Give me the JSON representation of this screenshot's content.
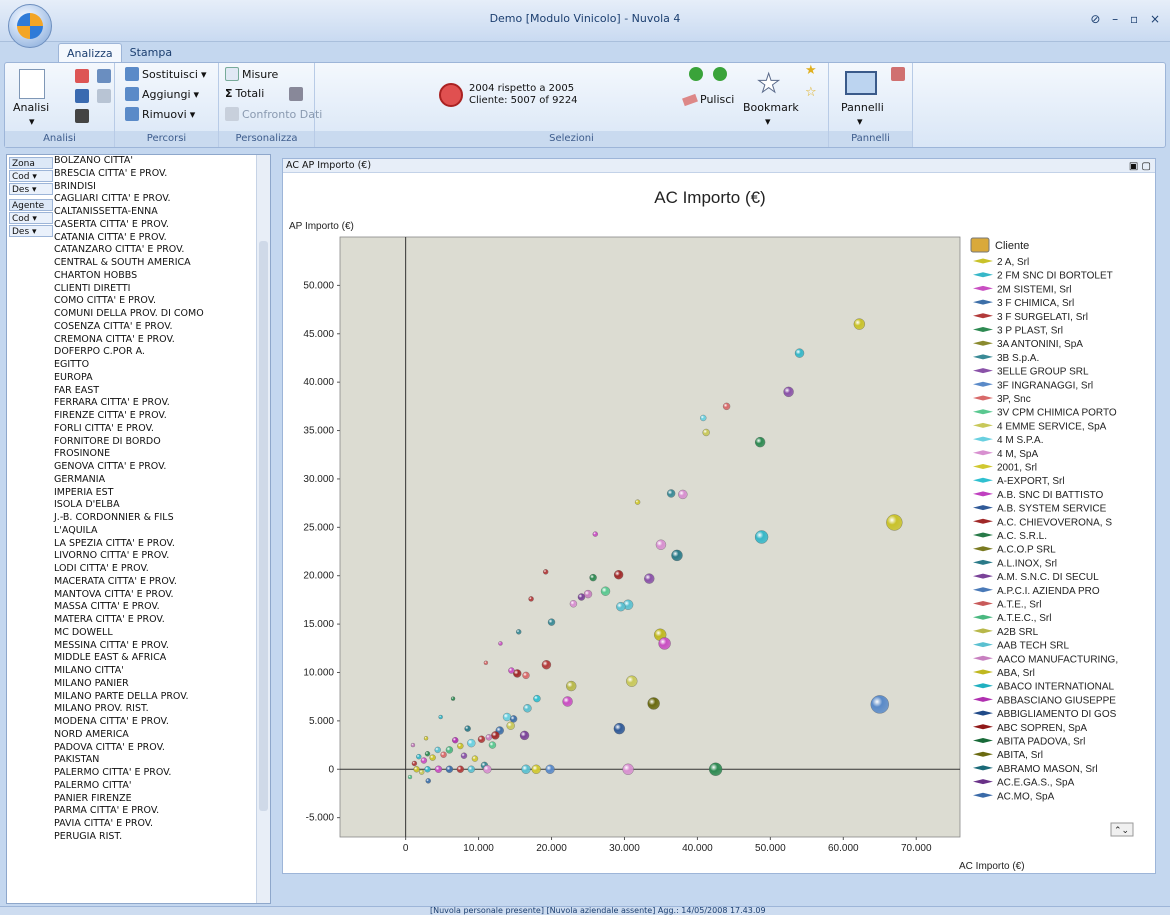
{
  "window": {
    "title": "Demo [Modulo Vinicolo] - Nuvola 4",
    "controls": "⊘ – ▫ ×"
  },
  "ribbon_tabs": [
    {
      "label": "Analizza",
      "active": true
    },
    {
      "label": "Stampa",
      "active": false
    }
  ],
  "ribbon": {
    "analisi": {
      "big_label": "Analisi",
      "group_label": "Analisi"
    },
    "percorsi": {
      "sostituisci": "Sostituisci",
      "aggiungi": "Aggiungi",
      "rimuovi": "Rimuovi",
      "group_label": "Percorsi"
    },
    "personalizza": {
      "misure": "Misure",
      "totali": "Totali",
      "confronto": "Confronto Dati",
      "group_label": "Personalizza"
    },
    "selezioni": {
      "line1": "2004 rispetto a  2005",
      "line2": "Cliente: 5007 of 9224",
      "pulisci": "Pulisci",
      "bookmark": "Bookmark",
      "group_label": "Selezioni"
    },
    "pannelli": {
      "label": "Pannelli",
      "group_label": "Pannelli"
    }
  },
  "left_panel": {
    "dimensions": [
      {
        "label": "Zona",
        "head": true
      },
      {
        "label": "Cod",
        "head": false
      },
      {
        "label": "Des",
        "head": false
      },
      {
        "label": "Agente",
        "head": true
      },
      {
        "label": "Cod",
        "head": false
      },
      {
        "label": "Des",
        "head": false
      }
    ],
    "zones": [
      "BOLZANO CITTA'",
      "BRESCIA CITTA' E PROV.",
      "BRINDISI",
      "CAGLIARI CITTA' E PROV.",
      "CALTANISSETTA-ENNA",
      "CASERTA CITTA' E PROV.",
      "CATANIA CITTA' E PROV.",
      "CATANZARO CITTA' E PROV.",
      "CENTRAL & SOUTH AMERICA",
      "CHARTON HOBBS",
      "CLIENTI DIRETTI",
      "COMO CITTA' E PROV.",
      "COMUNI DELLA PROV. DI COMO",
      "COSENZA CITTA' E PROV.",
      "CREMONA CITTA' E PROV.",
      "DOFERPO C.POR A.",
      "EGITTO",
      "EUROPA",
      "FAR EAST",
      "FERRARA CITTA' E PROV.",
      "FIRENZE CITTA' E PROV.",
      "FORLI CITTA' E PROV.",
      "FORNITORE DI BORDO",
      "FROSINONE",
      "GENOVA CITTA' E PROV.",
      "GERMANIA",
      "IMPERIA EST",
      "ISOLA D'ELBA",
      "J.-B. CORDONNIER & FILS",
      "L'AQUILA",
      "LA SPEZIA CITTA' E PROV.",
      "LIVORNO CITTA' E PROV.",
      "LODI CITTA' E PROV.",
      "MACERATA CITTA' E PROV.",
      "MANTOVA CITTA' E PROV.",
      "MASSA CITTA' E PROV.",
      "MATERA CITTA' E PROV.",
      "MC DOWELL",
      "MESSINA CITTA' E PROV.",
      "MIDDLE EAST & AFRICA",
      "MILANO CITTA'",
      "MILANO PANIER",
      "MILANO PARTE DELLA PROV.",
      "MILANO PROV. RIST.",
      "MODENA CITTA' E PROV.",
      "NORD AMERICA",
      "PADOVA CITTA' E PROV.",
      "PAKISTAN",
      "PALERMO  CITTA' E PROV.",
      "PALERMO CITTA'",
      "PANIER FIRENZE",
      "PARMA CITTA' E PROV.",
      "PAVIA CITTA' E PROV.",
      "PERUGIA RIST."
    ]
  },
  "chart_panel": {
    "header": "AC AP Importo (€)"
  },
  "chart_data": {
    "type": "scatter",
    "title": "AC Importo (€)",
    "xlabel": "AC Importo (€)",
    "ylabel": "AP Importo (€)",
    "xlim": [
      -9000,
      76000
    ],
    "ylim": [
      -7000,
      55000
    ],
    "xticks": [
      0,
      10000,
      20000,
      30000,
      40000,
      50000,
      60000,
      70000
    ],
    "xtick_labels": [
      "0",
      "10.000",
      "20.000",
      "30.000",
      "40.000",
      "50.000",
      "60.000",
      "70.000"
    ],
    "yticks": [
      -5000,
      0,
      5000,
      10000,
      15000,
      20000,
      25000,
      30000,
      35000,
      40000,
      45000,
      50000
    ],
    "ytick_labels": [
      "-5.000",
      "0",
      "5.000",
      "10.000",
      "15.000",
      "20.000",
      "25.000",
      "30.000",
      "35.000",
      "40.000",
      "45.000",
      "50.000"
    ],
    "plot_bg": "#dcdcd2",
    "legend_title": "Cliente",
    "legend": [
      {
        "name": "2 A, Srl",
        "color": "#c9c22a"
      },
      {
        "name": "2 FM SNC DI BORTOLET",
        "color": "#36b7c8"
      },
      {
        "name": "2M SISTEMI, Srl",
        "color": "#c94fc2"
      },
      {
        "name": "3 F CHIMICA, Srl",
        "color": "#3d6fa8"
      },
      {
        "name": "3 F SURGELATI, Srl",
        "color": "#b23a3a"
      },
      {
        "name": "3 P PLAST, Srl",
        "color": "#2e8a52"
      },
      {
        "name": "3A ANTONINI, SpA",
        "color": "#8a8a2e"
      },
      {
        "name": "3B S.p.A.",
        "color": "#3a8a96"
      },
      {
        "name": "3ELLE GROUP SRL",
        "color": "#8a52a8"
      },
      {
        "name": "3F INGRANAGGI, Srl",
        "color": "#5a8ac8"
      },
      {
        "name": "3P, Snc",
        "color": "#d86a6a"
      },
      {
        "name": "3V CPM CHIMICA PORTO",
        "color": "#5ac890"
      },
      {
        "name": "4 EMME SERVICE, SpA",
        "color": "#c8c85a"
      },
      {
        "name": "4 M S.P.A.",
        "color": "#6ad0e0"
      },
      {
        "name": "4 M, SpA",
        "color": "#d890d0"
      },
      {
        "name": "2001, Srl",
        "color": "#d0c830"
      },
      {
        "name": "A-EXPORT, Srl",
        "color": "#30c0d0"
      },
      {
        "name": "A.B. SNC DI BATTISTO",
        "color": "#c040c0"
      },
      {
        "name": "A.B. SYSTEM SERVICE",
        "color": "#305a98"
      },
      {
        "name": "A.C. CHIEVOVERONA, S",
        "color": "#a02828"
      },
      {
        "name": "A.C. S.R.L.",
        "color": "#287a48"
      },
      {
        "name": "A.C.O.P SRL",
        "color": "#7a7a20"
      },
      {
        "name": "A.L.INOX, Srl",
        "color": "#2a7a88"
      },
      {
        "name": "A.M. S.N.C. DI SECUL",
        "color": "#7a4298"
      },
      {
        "name": "A.P.C.I. AZIENDA PRO",
        "color": "#4a7ab8"
      },
      {
        "name": "A.T.E., Srl",
        "color": "#c85a5a"
      },
      {
        "name": "A.T.E.C., Srl",
        "color": "#4ab880"
      },
      {
        "name": "A2B SRL",
        "color": "#b8b84a"
      },
      {
        "name": "AAB TECH SRL",
        "color": "#5ac0d0"
      },
      {
        "name": "AACO MANUFACTURING,",
        "color": "#c880c0"
      },
      {
        "name": "ABA, Srl",
        "color": "#c0b820"
      },
      {
        "name": "ABACO INTERNATIONAL",
        "color": "#20b0c0"
      },
      {
        "name": "ABBASCIANO GIUSEPPE",
        "color": "#b030b0"
      },
      {
        "name": "ABBIGLIAMENTO DI GOS",
        "color": "#204a88"
      },
      {
        "name": "ABC SOPREN, SpA",
        "color": "#901818"
      },
      {
        "name": "ABITA PADOVA, Srl",
        "color": "#186a38"
      },
      {
        "name": "ABITA, Srl",
        "color": "#6a6a10"
      },
      {
        "name": "ABRAMO MASON, Srl",
        "color": "#1a6a78"
      },
      {
        "name": "AC.E.GA.S., SpA",
        "color": "#6a3288"
      },
      {
        "name": "AC.MO, SpA",
        "color": "#3a6aa8"
      }
    ],
    "points": [
      {
        "x": 62200,
        "y": 46000,
        "size": 9,
        "color": "#c9c22a"
      },
      {
        "x": 54000,
        "y": 43000,
        "size": 7,
        "color": "#36b7c8"
      },
      {
        "x": 52500,
        "y": 39000,
        "size": 8,
        "color": "#8a52a8"
      },
      {
        "x": 44000,
        "y": 37500,
        "size": 5,
        "color": "#d86a6a"
      },
      {
        "x": 40800,
        "y": 36300,
        "size": 4,
        "color": "#6ad0e0"
      },
      {
        "x": 41200,
        "y": 34800,
        "size": 5,
        "color": "#c8c85a"
      },
      {
        "x": 48600,
        "y": 33800,
        "size": 8,
        "color": "#2e8a52"
      },
      {
        "x": 36400,
        "y": 28500,
        "size": 6,
        "color": "#3a8a96"
      },
      {
        "x": 38000,
        "y": 28400,
        "size": 7,
        "color": "#d890d0"
      },
      {
        "x": 31800,
        "y": 27600,
        "size": 3,
        "color": "#d0c830"
      },
      {
        "x": 67000,
        "y": 25500,
        "size": 14,
        "color": "#c9c22a"
      },
      {
        "x": 48800,
        "y": 24000,
        "size": 11,
        "color": "#36b7c8"
      },
      {
        "x": 26000,
        "y": 24300,
        "size": 3,
        "color": "#c94fc2"
      },
      {
        "x": 35000,
        "y": 23200,
        "size": 8,
        "color": "#d890d0"
      },
      {
        "x": 37200,
        "y": 22100,
        "size": 9,
        "color": "#2a7a88"
      },
      {
        "x": 19200,
        "y": 20400,
        "size": 3,
        "color": "#b23a3a"
      },
      {
        "x": 29200,
        "y": 20100,
        "size": 7,
        "color": "#a02828"
      },
      {
        "x": 33400,
        "y": 19700,
        "size": 8,
        "color": "#8a52a8"
      },
      {
        "x": 25700,
        "y": 19800,
        "size": 5,
        "color": "#2e8a52"
      },
      {
        "x": 27400,
        "y": 18400,
        "size": 7,
        "color": "#5ac890"
      },
      {
        "x": 25000,
        "y": 18100,
        "size": 6,
        "color": "#c880c0"
      },
      {
        "x": 24100,
        "y": 17800,
        "size": 5,
        "color": "#7a4298"
      },
      {
        "x": 30500,
        "y": 17000,
        "size": 8,
        "color": "#5ac0d0"
      },
      {
        "x": 29500,
        "y": 16800,
        "size": 7,
        "color": "#5ac0d0"
      },
      {
        "x": 23000,
        "y": 17100,
        "size": 5,
        "color": "#d890d0"
      },
      {
        "x": 17200,
        "y": 17600,
        "size": 3,
        "color": "#b23a3a"
      },
      {
        "x": 20000,
        "y": 15200,
        "size": 5,
        "color": "#3a8a96"
      },
      {
        "x": 34900,
        "y": 13900,
        "size": 10,
        "color": "#c0b820"
      },
      {
        "x": 35500,
        "y": 13000,
        "size": 10,
        "color": "#c94fc2"
      },
      {
        "x": 15500,
        "y": 14200,
        "size": 3,
        "color": "#3a8a96"
      },
      {
        "x": 19300,
        "y": 10800,
        "size": 7,
        "color": "#b23a3a"
      },
      {
        "x": 15300,
        "y": 9900,
        "size": 6,
        "color": "#a02828"
      },
      {
        "x": 16500,
        "y": 9700,
        "size": 5,
        "color": "#d86a6a"
      },
      {
        "x": 14500,
        "y": 10200,
        "size": 4,
        "color": "#c94fc2"
      },
      {
        "x": 31000,
        "y": 9100,
        "size": 9,
        "color": "#c8c85a"
      },
      {
        "x": 22700,
        "y": 8600,
        "size": 8,
        "color": "#b8b84a"
      },
      {
        "x": 65000,
        "y": 6700,
        "size": 16,
        "color": "#5a8ac8"
      },
      {
        "x": 34000,
        "y": 6800,
        "size": 10,
        "color": "#6a6a10"
      },
      {
        "x": 22200,
        "y": 7000,
        "size": 8,
        "color": "#c94fc2"
      },
      {
        "x": 18000,
        "y": 7300,
        "size": 5,
        "color": "#30c0d0"
      },
      {
        "x": 16700,
        "y": 6300,
        "size": 6,
        "color": "#5ac0d0"
      },
      {
        "x": 13900,
        "y": 5400,
        "size": 6,
        "color": "#6ad0e0"
      },
      {
        "x": 14800,
        "y": 5200,
        "size": 5,
        "color": "#3d6fa8"
      },
      {
        "x": 14400,
        "y": 4500,
        "size": 6,
        "color": "#c8c85a"
      },
      {
        "x": 29300,
        "y": 4200,
        "size": 9,
        "color": "#305a98"
      },
      {
        "x": 12900,
        "y": 4000,
        "size": 6,
        "color": "#3d6fa8"
      },
      {
        "x": 12300,
        "y": 3500,
        "size": 6,
        "color": "#a02828"
      },
      {
        "x": 16300,
        "y": 3500,
        "size": 7,
        "color": "#7a4298"
      },
      {
        "x": 10400,
        "y": 3100,
        "size": 5,
        "color": "#b23a3a"
      },
      {
        "x": 11400,
        "y": 3300,
        "size": 4,
        "color": "#c880c0"
      },
      {
        "x": 8500,
        "y": 4200,
        "size": 4,
        "color": "#2a7a88"
      },
      {
        "x": 11900,
        "y": 2500,
        "size": 5,
        "color": "#5ac890"
      },
      {
        "x": 9000,
        "y": 2700,
        "size": 6,
        "color": "#6ad0e0"
      },
      {
        "x": 7500,
        "y": 2400,
        "size": 4,
        "color": "#c9c22a"
      },
      {
        "x": 6800,
        "y": 3000,
        "size": 4,
        "color": "#b030b0"
      },
      {
        "x": 6000,
        "y": 2000,
        "size": 5,
        "color": "#4ab880"
      },
      {
        "x": 5200,
        "y": 1500,
        "size": 4,
        "color": "#d86a6a"
      },
      {
        "x": 4400,
        "y": 2000,
        "size": 4,
        "color": "#5ac0d0"
      },
      {
        "x": 3700,
        "y": 1200,
        "size": 4,
        "color": "#c9c22a"
      },
      {
        "x": 3000,
        "y": 1600,
        "size": 3,
        "color": "#2e8a52"
      },
      {
        "x": 2500,
        "y": 900,
        "size": 4,
        "color": "#c94fc2"
      },
      {
        "x": 1800,
        "y": 1300,
        "size": 3,
        "color": "#36b7c8"
      },
      {
        "x": 1200,
        "y": 600,
        "size": 3,
        "color": "#b23a3a"
      },
      {
        "x": 8000,
        "y": 1400,
        "size": 4,
        "color": "#8a52a8"
      },
      {
        "x": 9500,
        "y": 1100,
        "size": 4,
        "color": "#d0c830"
      },
      {
        "x": 10800,
        "y": 400,
        "size": 5,
        "color": "#3a8a96"
      },
      {
        "x": 2200,
        "y": -300,
        "size": 3,
        "color": "#c8c85a"
      },
      {
        "x": 3100,
        "y": -1200,
        "size": 3,
        "color": "#3d6fa8"
      },
      {
        "x": 600,
        "y": -800,
        "size": 2,
        "color": "#5ac890"
      },
      {
        "x": 1000,
        "y": 2500,
        "size": 2,
        "color": "#c880c0"
      },
      {
        "x": 2800,
        "y": 3200,
        "size": 2,
        "color": "#d0c830"
      },
      {
        "x": 4800,
        "y": 5400,
        "size": 2,
        "color": "#36b7c8"
      },
      {
        "x": 6500,
        "y": 7300,
        "size": 2,
        "color": "#2e8a52"
      },
      {
        "x": 11000,
        "y": 11000,
        "size": 2,
        "color": "#d86a6a"
      },
      {
        "x": 13000,
        "y": 13000,
        "size": 2,
        "color": "#c94fc2"
      },
      {
        "x": 1500,
        "y": 0,
        "size": 4,
        "color": "#c9c22a"
      },
      {
        "x": 3000,
        "y": 0,
        "size": 4,
        "color": "#36b7c8"
      },
      {
        "x": 4500,
        "y": 0,
        "size": 5,
        "color": "#c94fc2"
      },
      {
        "x": 6000,
        "y": 0,
        "size": 5,
        "color": "#3d6fa8"
      },
      {
        "x": 7500,
        "y": 0,
        "size": 5,
        "color": "#b23a3a"
      },
      {
        "x": 9000,
        "y": 0,
        "size": 5,
        "color": "#5ac0d0"
      },
      {
        "x": 11200,
        "y": 0,
        "size": 6,
        "color": "#d890d0"
      },
      {
        "x": 16500,
        "y": 0,
        "size": 7,
        "color": "#5ac0d0"
      },
      {
        "x": 17900,
        "y": 0,
        "size": 7,
        "color": "#d0c830"
      },
      {
        "x": 19800,
        "y": 0,
        "size": 7,
        "color": "#5a8ac8"
      },
      {
        "x": 30500,
        "y": 0,
        "size": 9,
        "color": "#d890d0"
      },
      {
        "x": 42500,
        "y": 0,
        "size": 11,
        "color": "#2e8a52"
      }
    ]
  },
  "statusbar": {
    "text": "[Nuvola personale presente]   [Nuvola aziendale assente]     Agg.: 14/05/2008 17.43.09"
  }
}
